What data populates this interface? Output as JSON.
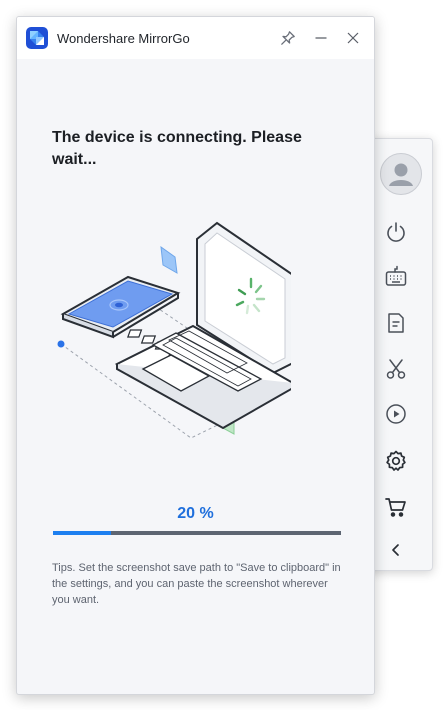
{
  "window": {
    "title": "Wondershare MirrorGo",
    "controls": [
      "pin-icon",
      "minimize-icon",
      "close-icon"
    ]
  },
  "main": {
    "heading": "The device is connecting. Please wait...",
    "progress": {
      "label": "20 %",
      "fraction": 0.2
    },
    "tips": "Tips. Set the screenshot save path to \"Save to clipboard\" in the settings, and you can paste the screenshot wherever you want."
  },
  "side_toolbar": {
    "items": [
      "avatar",
      "power-icon",
      "keyboard-icon",
      "file-icon",
      "scissors-icon",
      "record-icon",
      "settings-icon",
      "cart-icon",
      "collapse-chevron-icon"
    ]
  },
  "colors": {
    "accent": "#1d7ff0",
    "progress_track": "#5d6572",
    "brand": "#1f4fd6"
  }
}
